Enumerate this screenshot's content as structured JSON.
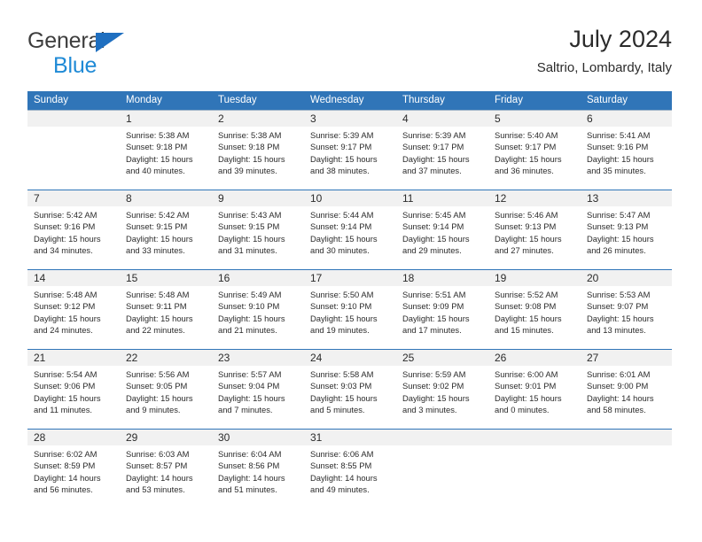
{
  "brand": {
    "line1": "General",
    "line2": "Blue",
    "triangle_icon": "triangle-logo-icon"
  },
  "header": {
    "title": "July 2024",
    "subtitle": "Saltrio, Lombardy, Italy"
  },
  "colors": {
    "header_blue": "#3075b8",
    "brand_blue": "#1f8ad6",
    "triangle_blue": "#1f6fc0",
    "daynum_band": "#f1f1f1",
    "week_separator": "#3075b8",
    "week_separator_faint": "#9fb4c9",
    "text": "#2b2b2b"
  },
  "labels": {
    "sunrise_prefix": "Sunrise:",
    "sunset_prefix": "Sunset:",
    "daylight_prefix": "Daylight:"
  },
  "weekdays": [
    "Sunday",
    "Monday",
    "Tuesday",
    "Wednesday",
    "Thursday",
    "Friday",
    "Saturday"
  ],
  "weeks": [
    {
      "separator": "faint",
      "days": [
        {
          "num": "",
          "lines": []
        },
        {
          "num": "1",
          "lines": [
            "Sunrise: 5:38 AM",
            "Sunset: 9:18 PM",
            "Daylight: 15 hours",
            "and 40 minutes."
          ]
        },
        {
          "num": "2",
          "lines": [
            "Sunrise: 5:38 AM",
            "Sunset: 9:18 PM",
            "Daylight: 15 hours",
            "and 39 minutes."
          ]
        },
        {
          "num": "3",
          "lines": [
            "Sunrise: 5:39 AM",
            "Sunset: 9:17 PM",
            "Daylight: 15 hours",
            "and 38 minutes."
          ]
        },
        {
          "num": "4",
          "lines": [
            "Sunrise: 5:39 AM",
            "Sunset: 9:17 PM",
            "Daylight: 15 hours",
            "and 37 minutes."
          ]
        },
        {
          "num": "5",
          "lines": [
            "Sunrise: 5:40 AM",
            "Sunset: 9:17 PM",
            "Daylight: 15 hours",
            "and 36 minutes."
          ]
        },
        {
          "num": "6",
          "lines": [
            "Sunrise: 5:41 AM",
            "Sunset: 9:16 PM",
            "Daylight: 15 hours",
            "and 35 minutes."
          ]
        }
      ]
    },
    {
      "separator": "solid",
      "days": [
        {
          "num": "7",
          "lines": [
            "Sunrise: 5:42 AM",
            "Sunset: 9:16 PM",
            "Daylight: 15 hours",
            "and 34 minutes."
          ]
        },
        {
          "num": "8",
          "lines": [
            "Sunrise: 5:42 AM",
            "Sunset: 9:15 PM",
            "Daylight: 15 hours",
            "and 33 minutes."
          ]
        },
        {
          "num": "9",
          "lines": [
            "Sunrise: 5:43 AM",
            "Sunset: 9:15 PM",
            "Daylight: 15 hours",
            "and 31 minutes."
          ]
        },
        {
          "num": "10",
          "lines": [
            "Sunrise: 5:44 AM",
            "Sunset: 9:14 PM",
            "Daylight: 15 hours",
            "and 30 minutes."
          ]
        },
        {
          "num": "11",
          "lines": [
            "Sunrise: 5:45 AM",
            "Sunset: 9:14 PM",
            "Daylight: 15 hours",
            "and 29 minutes."
          ]
        },
        {
          "num": "12",
          "lines": [
            "Sunrise: 5:46 AM",
            "Sunset: 9:13 PM",
            "Daylight: 15 hours",
            "and 27 minutes."
          ]
        },
        {
          "num": "13",
          "lines": [
            "Sunrise: 5:47 AM",
            "Sunset: 9:13 PM",
            "Daylight: 15 hours",
            "and 26 minutes."
          ]
        }
      ]
    },
    {
      "separator": "solid",
      "days": [
        {
          "num": "14",
          "lines": [
            "Sunrise: 5:48 AM",
            "Sunset: 9:12 PM",
            "Daylight: 15 hours",
            "and 24 minutes."
          ]
        },
        {
          "num": "15",
          "lines": [
            "Sunrise: 5:48 AM",
            "Sunset: 9:11 PM",
            "Daylight: 15 hours",
            "and 22 minutes."
          ]
        },
        {
          "num": "16",
          "lines": [
            "Sunrise: 5:49 AM",
            "Sunset: 9:10 PM",
            "Daylight: 15 hours",
            "and 21 minutes."
          ]
        },
        {
          "num": "17",
          "lines": [
            "Sunrise: 5:50 AM",
            "Sunset: 9:10 PM",
            "Daylight: 15 hours",
            "and 19 minutes."
          ]
        },
        {
          "num": "18",
          "lines": [
            "Sunrise: 5:51 AM",
            "Sunset: 9:09 PM",
            "Daylight: 15 hours",
            "and 17 minutes."
          ]
        },
        {
          "num": "19",
          "lines": [
            "Sunrise: 5:52 AM",
            "Sunset: 9:08 PM",
            "Daylight: 15 hours",
            "and 15 minutes."
          ]
        },
        {
          "num": "20",
          "lines": [
            "Sunrise: 5:53 AM",
            "Sunset: 9:07 PM",
            "Daylight: 15 hours",
            "and 13 minutes."
          ]
        }
      ]
    },
    {
      "separator": "solid",
      "days": [
        {
          "num": "21",
          "lines": [
            "Sunrise: 5:54 AM",
            "Sunset: 9:06 PM",
            "Daylight: 15 hours",
            "and 11 minutes."
          ]
        },
        {
          "num": "22",
          "lines": [
            "Sunrise: 5:56 AM",
            "Sunset: 9:05 PM",
            "Daylight: 15 hours",
            "and 9 minutes."
          ]
        },
        {
          "num": "23",
          "lines": [
            "Sunrise: 5:57 AM",
            "Sunset: 9:04 PM",
            "Daylight: 15 hours",
            "and 7 minutes."
          ]
        },
        {
          "num": "24",
          "lines": [
            "Sunrise: 5:58 AM",
            "Sunset: 9:03 PM",
            "Daylight: 15 hours",
            "and 5 minutes."
          ]
        },
        {
          "num": "25",
          "lines": [
            "Sunrise: 5:59 AM",
            "Sunset: 9:02 PM",
            "Daylight: 15 hours",
            "and 3 minutes."
          ]
        },
        {
          "num": "26",
          "lines": [
            "Sunrise: 6:00 AM",
            "Sunset: 9:01 PM",
            "Daylight: 15 hours",
            "and 0 minutes."
          ]
        },
        {
          "num": "27",
          "lines": [
            "Sunrise: 6:01 AM",
            "Sunset: 9:00 PM",
            "Daylight: 14 hours",
            "and 58 minutes."
          ]
        }
      ]
    },
    {
      "separator": "solid",
      "days": [
        {
          "num": "28",
          "lines": [
            "Sunrise: 6:02 AM",
            "Sunset: 8:59 PM",
            "Daylight: 14 hours",
            "and 56 minutes."
          ]
        },
        {
          "num": "29",
          "lines": [
            "Sunrise: 6:03 AM",
            "Sunset: 8:57 PM",
            "Daylight: 14 hours",
            "and 53 minutes."
          ]
        },
        {
          "num": "30",
          "lines": [
            "Sunrise: 6:04 AM",
            "Sunset: 8:56 PM",
            "Daylight: 14 hours",
            "and 51 minutes."
          ]
        },
        {
          "num": "31",
          "lines": [
            "Sunrise: 6:06 AM",
            "Sunset: 8:55 PM",
            "Daylight: 14 hours",
            "and 49 minutes."
          ]
        },
        {
          "num": "",
          "lines": []
        },
        {
          "num": "",
          "lines": []
        },
        {
          "num": "",
          "lines": []
        }
      ]
    }
  ]
}
